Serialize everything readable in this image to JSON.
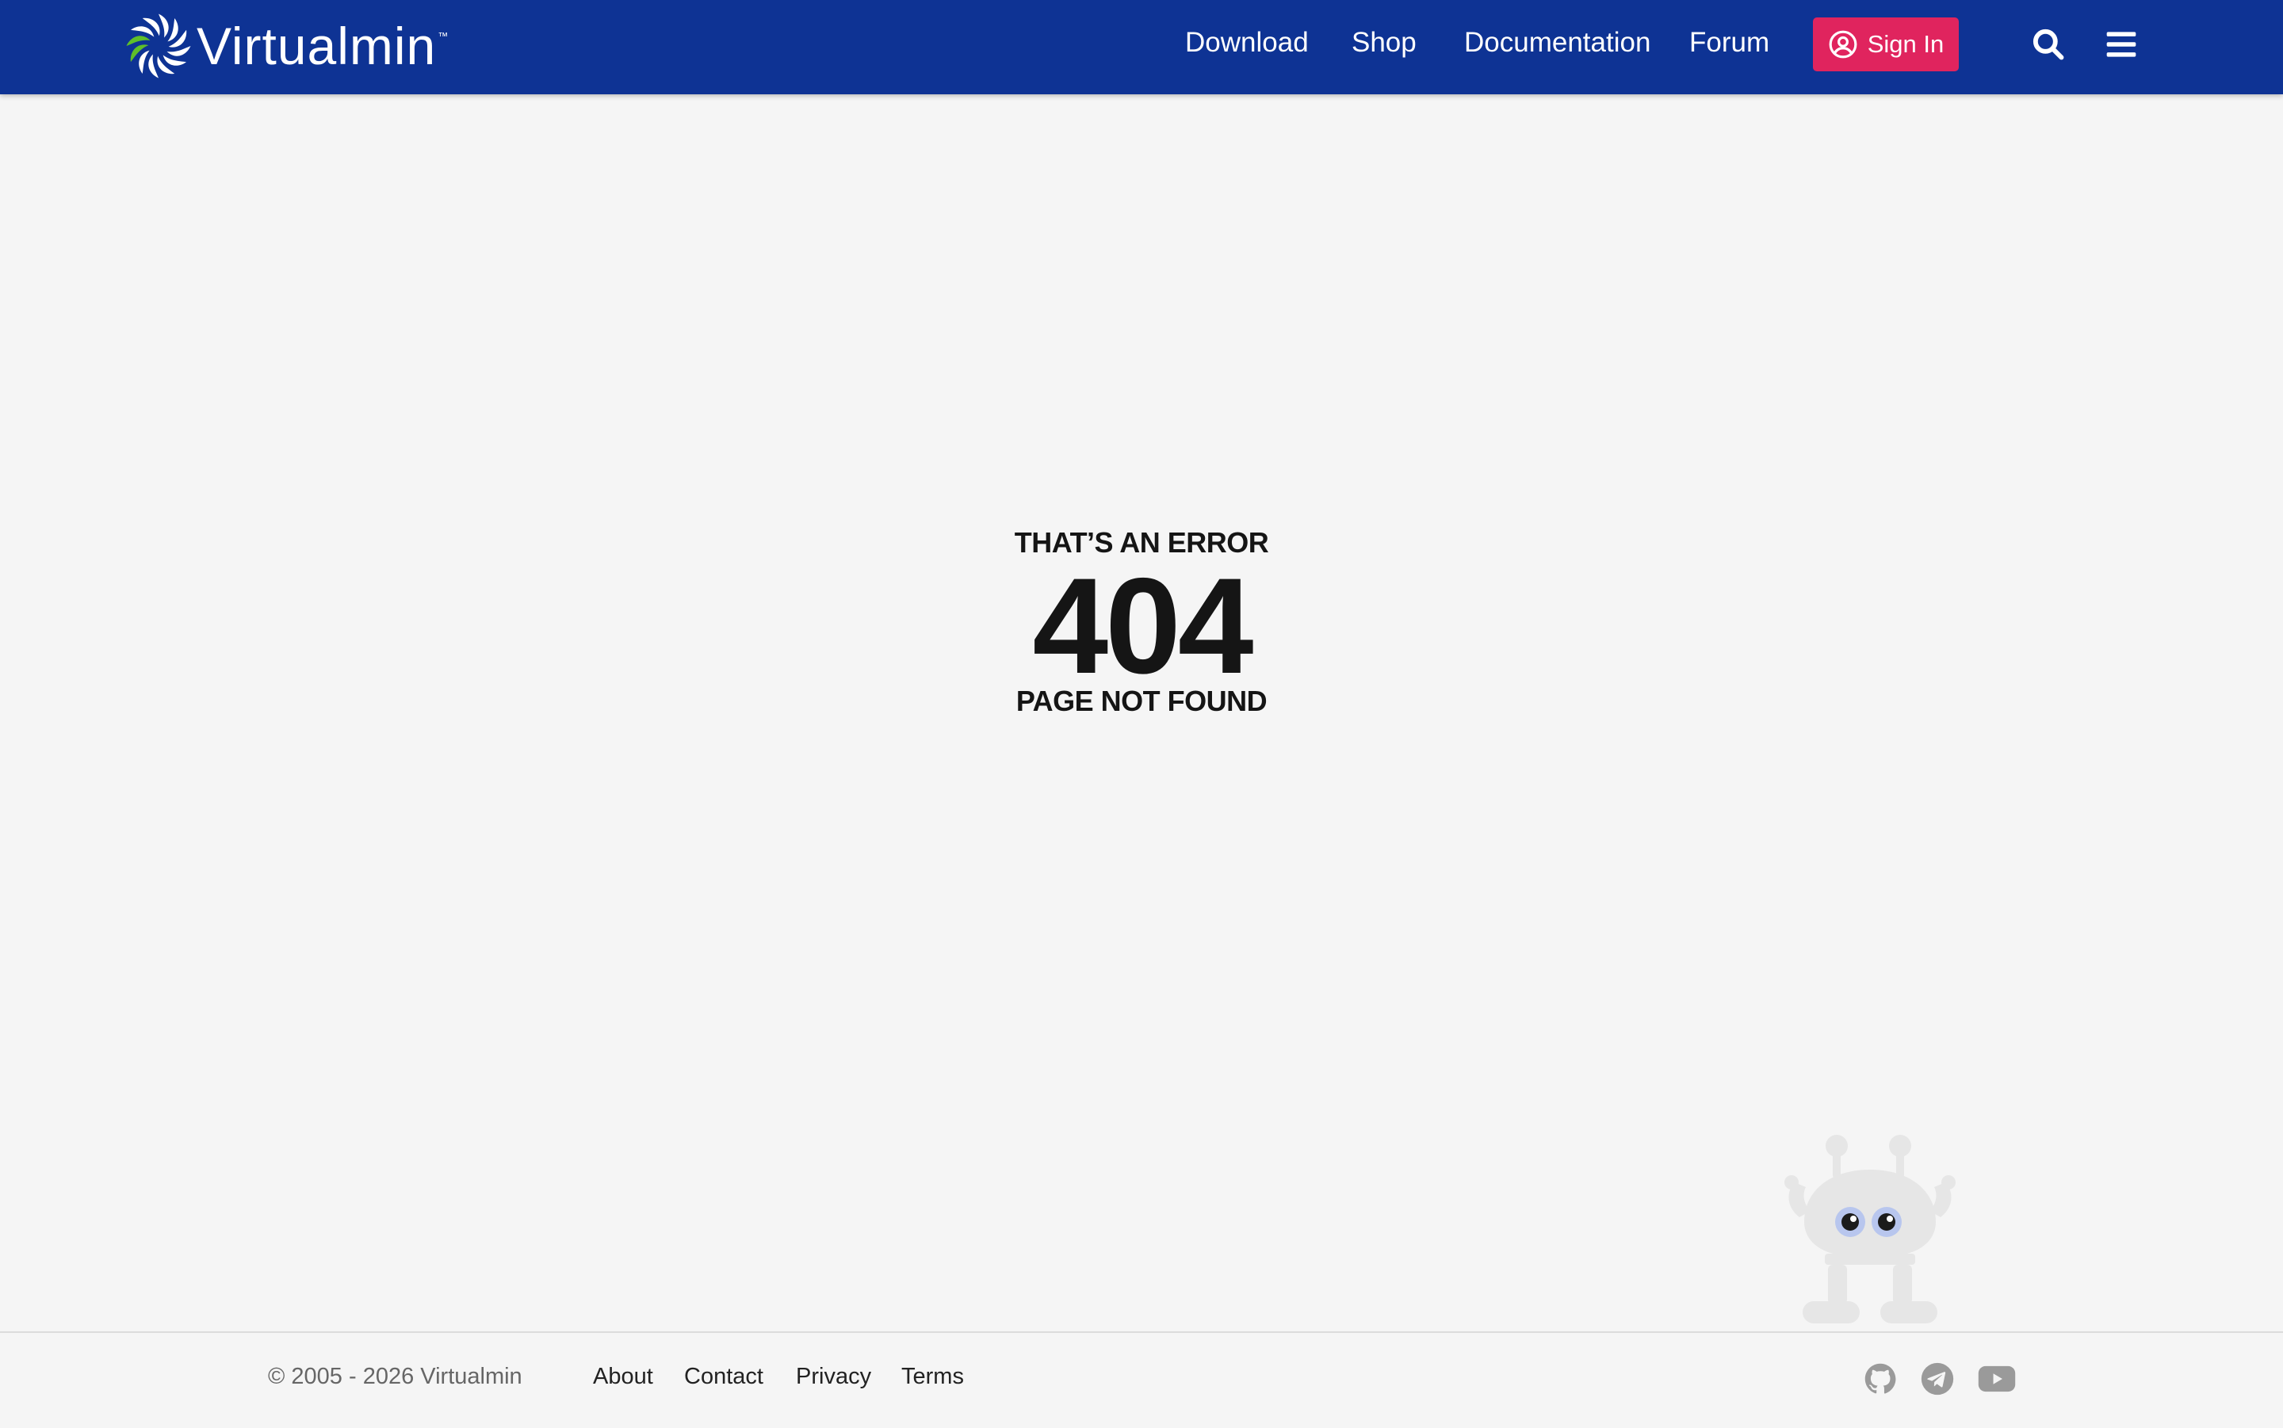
{
  "header": {
    "brand": "Virtualmin",
    "trademark": "™",
    "nav": [
      {
        "label": "Download"
      },
      {
        "label": "Shop"
      },
      {
        "label": "Documentation"
      },
      {
        "label": "Forum"
      }
    ],
    "signin_label": "Sign In",
    "icons": [
      "user-circle-icon",
      "search-icon",
      "menu-icon"
    ],
    "colors": {
      "bar": "#0e3394",
      "signin": "#e0245e"
    }
  },
  "error": {
    "heading": "THAT’S AN ERROR",
    "code": "404",
    "message": "PAGE NOT FOUND"
  },
  "footer": {
    "copyright": "© 2005 - 2026 Virtualmin",
    "links": [
      {
        "label": "About"
      },
      {
        "label": "Contact"
      },
      {
        "label": "Privacy"
      },
      {
        "label": "Terms"
      }
    ],
    "social_icons": [
      "github-icon",
      "telegram-icon",
      "youtube-icon"
    ]
  }
}
